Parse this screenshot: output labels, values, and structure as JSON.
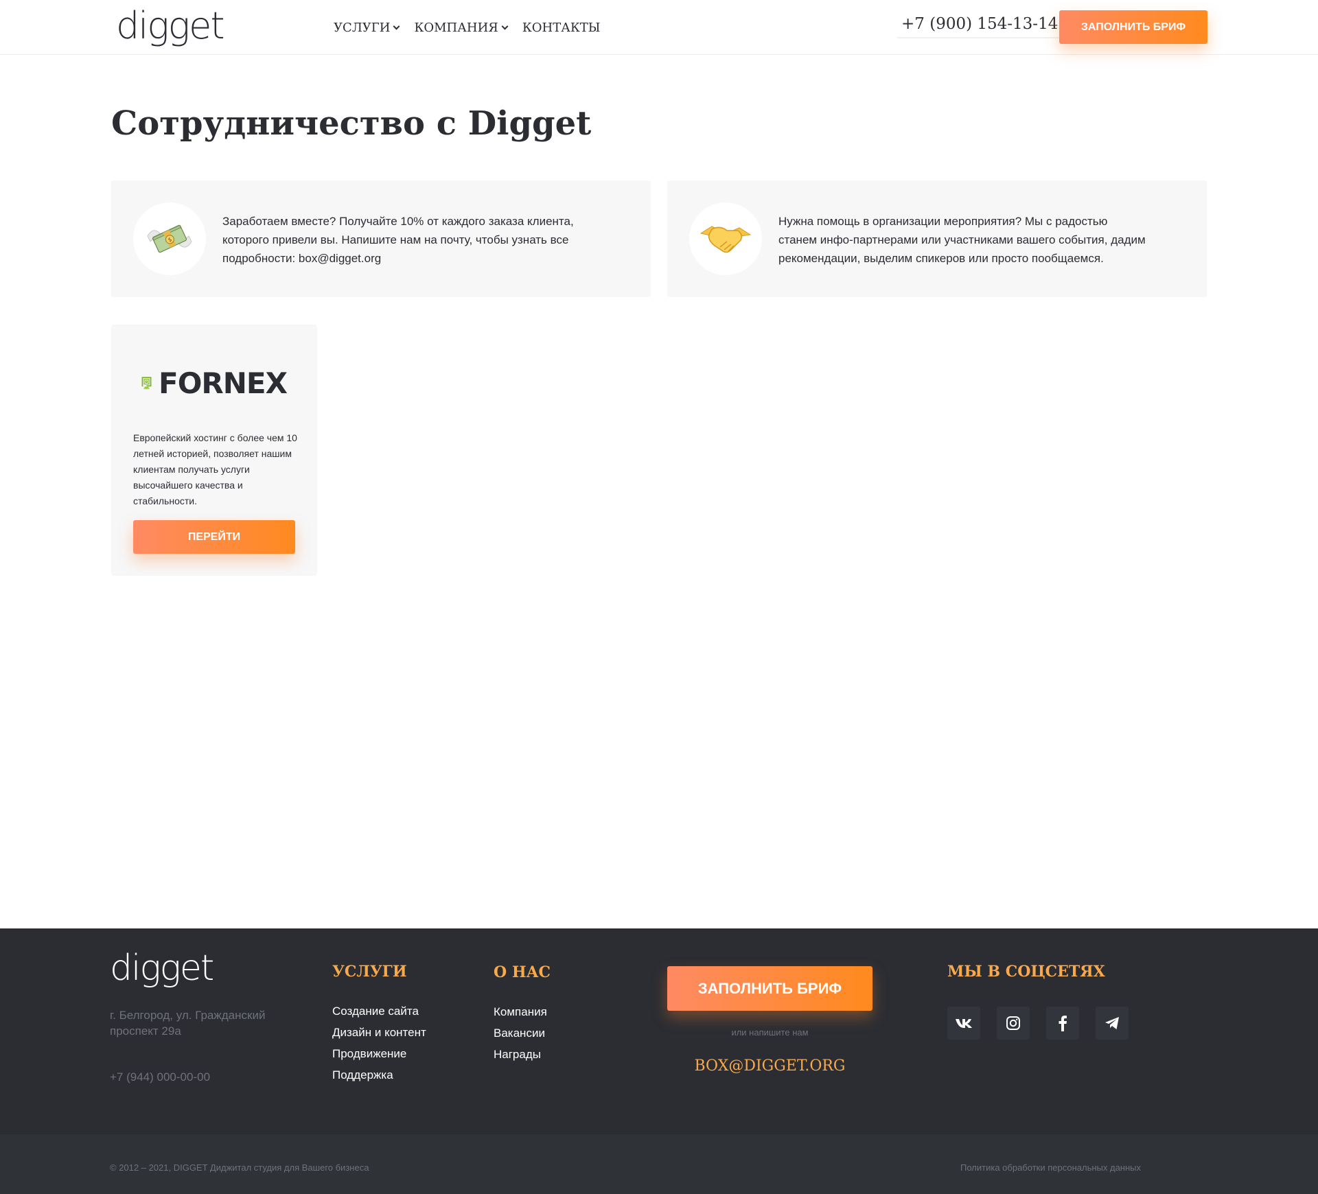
{
  "header": {
    "logo": "digget",
    "nav": [
      {
        "label": "УСЛУГИ"
      },
      {
        "label": "КОМПАНИЯ"
      },
      {
        "label": "КОНТАКТЫ"
      }
    ],
    "phone": "+7 (900) 154-13-14",
    "brief_button": "ЗАПОЛНИТЬ БРИФ"
  },
  "main": {
    "title": "Сотрудничество с Digget",
    "cards": [
      {
        "icon": "money-with-wings-icon",
        "text": "Заработаем вместе? Получайте 10% от каждого заказа клиента, которого привели вы. Напишите нам на почту, чтобы узнать все подробности: box@digget.org"
      },
      {
        "icon": "handshake-icon",
        "text": "Нужна помощь в организации мероприятия? Мы с радостью станем инфо-партнерами или участниками вашего события, дадим рекомендации, выделим спикеров или просто пообщаемся."
      }
    ],
    "partner": {
      "logo_text": "FORNEX",
      "description": "Европейский хостинг с более чем 10 летней историей, позволяет нашим клиентам получать услуги высочайшего качества и стабильности.",
      "button": "ПЕРЕЙТИ"
    }
  },
  "footer": {
    "logo": "digget",
    "address": "г. Белгород, ул. Гражданский проспект 29а",
    "phone": "+7 (944) 000-00-00",
    "services": {
      "heading": "УСЛУГИ",
      "links": [
        "Создание сайта",
        "Дизайн и контент",
        "Продвижение",
        "Поддержка"
      ]
    },
    "about": {
      "heading": "О НАС",
      "links": [
        "Компания",
        "Вакансии",
        "Награды"
      ]
    },
    "brief_button": "ЗАПОЛНИТЬ БРИФ",
    "or_write": "или напишите нам",
    "email": "BOX@DIGGET.ORG",
    "socials": {
      "heading": "МЫ В СОЦСЕТЯХ",
      "items": [
        "vk-icon",
        "instagram-icon",
        "facebook-icon",
        "telegram-icon"
      ]
    },
    "copyright": "© 2012 – 2021, DIGGET Диджитал студия для Вашего бизнеса",
    "policy": "Политика обработки персональных данных"
  },
  "colors": {
    "accent": "#ff8a1f",
    "accent_light": "#ff8a63",
    "footer_heading": "#f7a94b",
    "footer_bg": "#2b2d33",
    "text": "#2b2d33",
    "fornex_green": "#7ab51d"
  }
}
